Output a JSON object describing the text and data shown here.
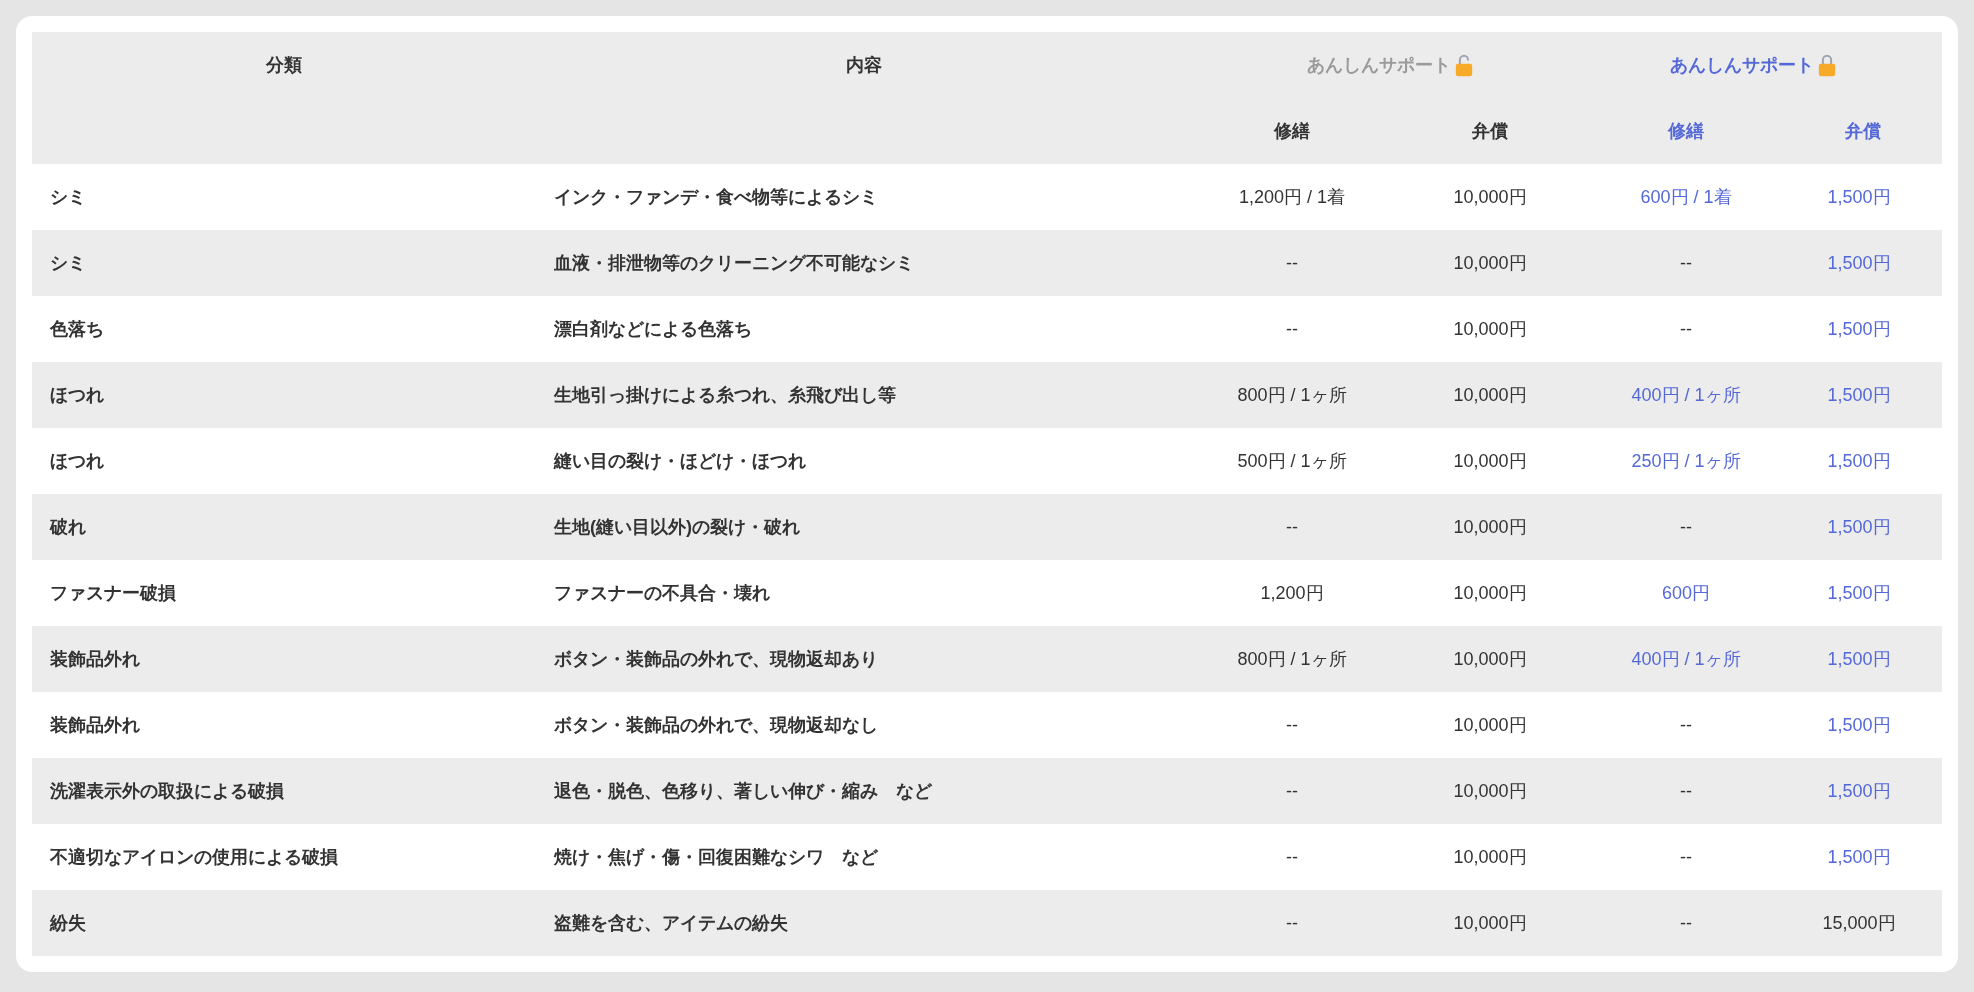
{
  "columns": {
    "category": "分類",
    "content": "内容"
  },
  "plans": [
    {
      "label": "あんしんサポート",
      "active": false,
      "repair": "修繕",
      "compensation": "弁償"
    },
    {
      "label": "あんしんサポート",
      "active": true,
      "repair": "修繕",
      "compensation": "弁償"
    }
  ],
  "rows": [
    {
      "category": "シミ",
      "content": "インク・ファンデ・食べ物等によるシミ",
      "prices": [
        {
          "repair": {
            "text": "1,200円 / 1着",
            "discounted": false
          },
          "compensation": {
            "text": "10,000円",
            "discounted": false
          }
        },
        {
          "repair": {
            "text": "600円 / 1着",
            "discounted": true
          },
          "compensation": {
            "text": "1,500円",
            "discounted": true
          }
        }
      ]
    },
    {
      "category": "シミ",
      "content": "血液・排泄物等のクリーニング不可能なシミ",
      "prices": [
        {
          "repair": {
            "text": "--",
            "discounted": false
          },
          "compensation": {
            "text": "10,000円",
            "discounted": false
          }
        },
        {
          "repair": {
            "text": "--",
            "discounted": false
          },
          "compensation": {
            "text": "1,500円",
            "discounted": true
          }
        }
      ]
    },
    {
      "category": "色落ち",
      "content": "漂白剤などによる色落ち",
      "prices": [
        {
          "repair": {
            "text": "--",
            "discounted": false
          },
          "compensation": {
            "text": "10,000円",
            "discounted": false
          }
        },
        {
          "repair": {
            "text": "--",
            "discounted": false
          },
          "compensation": {
            "text": "1,500円",
            "discounted": true
          }
        }
      ]
    },
    {
      "category": "ほつれ",
      "content": "生地引っ掛けによる糸つれ、糸飛び出し等",
      "prices": [
        {
          "repair": {
            "text": "800円 / 1ヶ所",
            "discounted": false
          },
          "compensation": {
            "text": "10,000円",
            "discounted": false
          }
        },
        {
          "repair": {
            "text": "400円 / 1ヶ所",
            "discounted": true
          },
          "compensation": {
            "text": "1,500円",
            "discounted": true
          }
        }
      ]
    },
    {
      "category": "ほつれ",
      "content": "縫い目の裂け・ほどけ・ほつれ",
      "prices": [
        {
          "repair": {
            "text": "500円 / 1ヶ所",
            "discounted": false
          },
          "compensation": {
            "text": "10,000円",
            "discounted": false
          }
        },
        {
          "repair": {
            "text": "250円 / 1ヶ所",
            "discounted": true
          },
          "compensation": {
            "text": "1,500円",
            "discounted": true
          }
        }
      ]
    },
    {
      "category": "破れ",
      "content": "生地(縫い目以外)の裂け・破れ",
      "prices": [
        {
          "repair": {
            "text": "--",
            "discounted": false
          },
          "compensation": {
            "text": "10,000円",
            "discounted": false
          }
        },
        {
          "repair": {
            "text": "--",
            "discounted": false
          },
          "compensation": {
            "text": "1,500円",
            "discounted": true
          }
        }
      ]
    },
    {
      "category": "ファスナー破損",
      "content": "ファスナーの不具合・壊れ",
      "prices": [
        {
          "repair": {
            "text": "1,200円",
            "discounted": false
          },
          "compensation": {
            "text": "10,000円",
            "discounted": false
          }
        },
        {
          "repair": {
            "text": "600円",
            "discounted": true
          },
          "compensation": {
            "text": "1,500円",
            "discounted": true
          }
        }
      ]
    },
    {
      "category": "装飾品外れ",
      "content": "ボタン・装飾品の外れで、現物返却あり",
      "prices": [
        {
          "repair": {
            "text": "800円 / 1ヶ所",
            "discounted": false
          },
          "compensation": {
            "text": "10,000円",
            "discounted": false
          }
        },
        {
          "repair": {
            "text": "400円 / 1ヶ所",
            "discounted": true
          },
          "compensation": {
            "text": "1,500円",
            "discounted": true
          }
        }
      ]
    },
    {
      "category": "装飾品外れ",
      "content": "ボタン・装飾品の外れで、現物返却なし",
      "prices": [
        {
          "repair": {
            "text": "--",
            "discounted": false
          },
          "compensation": {
            "text": "10,000円",
            "discounted": false
          }
        },
        {
          "repair": {
            "text": "--",
            "discounted": false
          },
          "compensation": {
            "text": "1,500円",
            "discounted": true
          }
        }
      ]
    },
    {
      "category": "洗濯表示外の取扱による破損",
      "content": "退色・脱色、色移り、著しい伸び・縮み　など",
      "prices": [
        {
          "repair": {
            "text": "--",
            "discounted": false
          },
          "compensation": {
            "text": "10,000円",
            "discounted": false
          }
        },
        {
          "repair": {
            "text": "--",
            "discounted": false
          },
          "compensation": {
            "text": "1,500円",
            "discounted": true
          }
        }
      ]
    },
    {
      "category": "不適切なアイロンの使用による破損",
      "content": "焼け・焦げ・傷・回復困難なシワ　など",
      "prices": [
        {
          "repair": {
            "text": "--",
            "discounted": false
          },
          "compensation": {
            "text": "10,000円",
            "discounted": false
          }
        },
        {
          "repair": {
            "text": "--",
            "discounted": false
          },
          "compensation": {
            "text": "1,500円",
            "discounted": true
          }
        }
      ]
    },
    {
      "category": "紛失",
      "content": "盗難を含む、アイテムの紛失",
      "prices": [
        {
          "repair": {
            "text": "--",
            "discounted": false
          },
          "compensation": {
            "text": "10,000円",
            "discounted": false
          }
        },
        {
          "repair": {
            "text": "--",
            "discounted": false
          },
          "compensation": {
            "text": "15,000円",
            "discounted": false
          }
        }
      ]
    }
  ]
}
